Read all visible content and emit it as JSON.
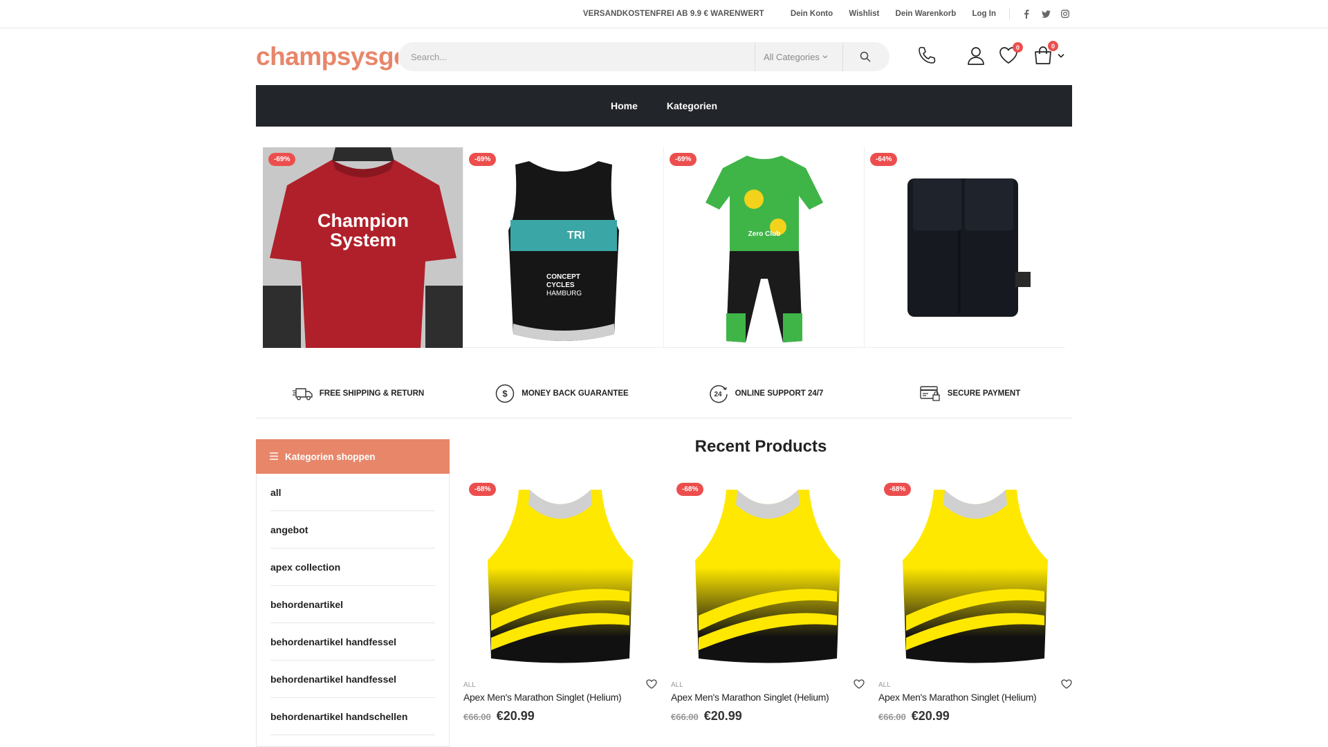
{
  "topbar": {
    "promo": "VERSANDKOSTENFREI AB 9.9 € WARENWERT",
    "links": [
      "Dein Konto",
      "Wishlist",
      "Dein Warenkorb",
      "Log In"
    ],
    "social": [
      "facebook-icon",
      "twitter-icon",
      "instagram-icon"
    ]
  },
  "header": {
    "logo": "champsysgear",
    "search_placeholder": "Search...",
    "category_select": "All Categories",
    "wishlist_count": "0",
    "cart_count": "0"
  },
  "nav": {
    "items": [
      "Home",
      "Kategorien"
    ]
  },
  "banner": {
    "discounts": [
      "-69%",
      "-69%",
      "-69%",
      "-64%"
    ]
  },
  "features": [
    "FREE SHIPPING & RETURN",
    "MONEY BACK GUARANTEE",
    "ONLINE SUPPORT 24/7",
    "SECURE PAYMENT"
  ],
  "sidebar": {
    "title": "Kategorien shoppen",
    "items": [
      "all",
      "angebot",
      "apex collection",
      "behordenartikel",
      "behordenartikel handfessel",
      "behordenartikel handfessel",
      "behordenartikel handschellen"
    ]
  },
  "recent": {
    "title": "Recent Products",
    "products": [
      {
        "discount": "-68%",
        "category": "ALL",
        "name": "Apex Men's Marathon Singlet (Helium)",
        "old_price": "€66.00",
        "price": "€20.99"
      },
      {
        "discount": "-68%",
        "category": "ALL",
        "name": "Apex Men's Marathon Singlet (Helium)",
        "old_price": "€66.00",
        "price": "€20.99"
      },
      {
        "discount": "-68%",
        "category": "ALL",
        "name": "Apex Men's Marathon Singlet (Helium)",
        "old_price": "€66.00",
        "price": "€20.99"
      }
    ]
  },
  "colors": {
    "accent": "#e8866a",
    "sale": "#ec4e4e",
    "nav_bg": "#222529"
  }
}
